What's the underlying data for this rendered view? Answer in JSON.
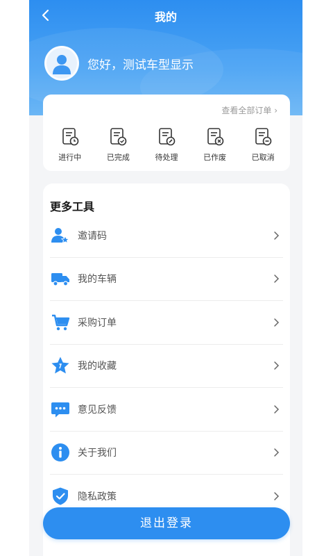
{
  "nav": {
    "title": "我的"
  },
  "profile": {
    "greeting": "您好，测试车型显示"
  },
  "orders": {
    "view_all": "查看全部订单",
    "items": [
      {
        "label": "进行中",
        "icon": "order-in-progress-icon"
      },
      {
        "label": "已完成",
        "icon": "order-completed-icon"
      },
      {
        "label": "待处理",
        "icon": "order-pending-icon"
      },
      {
        "label": "已作废",
        "icon": "order-voided-icon"
      },
      {
        "label": "已取消",
        "icon": "order-cancelled-icon"
      }
    ]
  },
  "tools": {
    "title": "更多工具",
    "items": [
      {
        "label": "邀请码",
        "icon": "invite-user-icon"
      },
      {
        "label": "我的车辆",
        "icon": "truck-icon"
      },
      {
        "label": "采购订单",
        "icon": "cart-icon"
      },
      {
        "label": "我的收藏",
        "icon": "star-icon"
      },
      {
        "label": "意见反馈",
        "icon": "feedback-chat-icon"
      },
      {
        "label": "关于我们",
        "icon": "info-icon"
      },
      {
        "label": "隐私政策",
        "icon": "shield-check-icon"
      }
    ]
  },
  "logout": {
    "label": "退出登录"
  },
  "colors": {
    "primary": "#2d8ef0",
    "background": "#f4f5f7"
  }
}
